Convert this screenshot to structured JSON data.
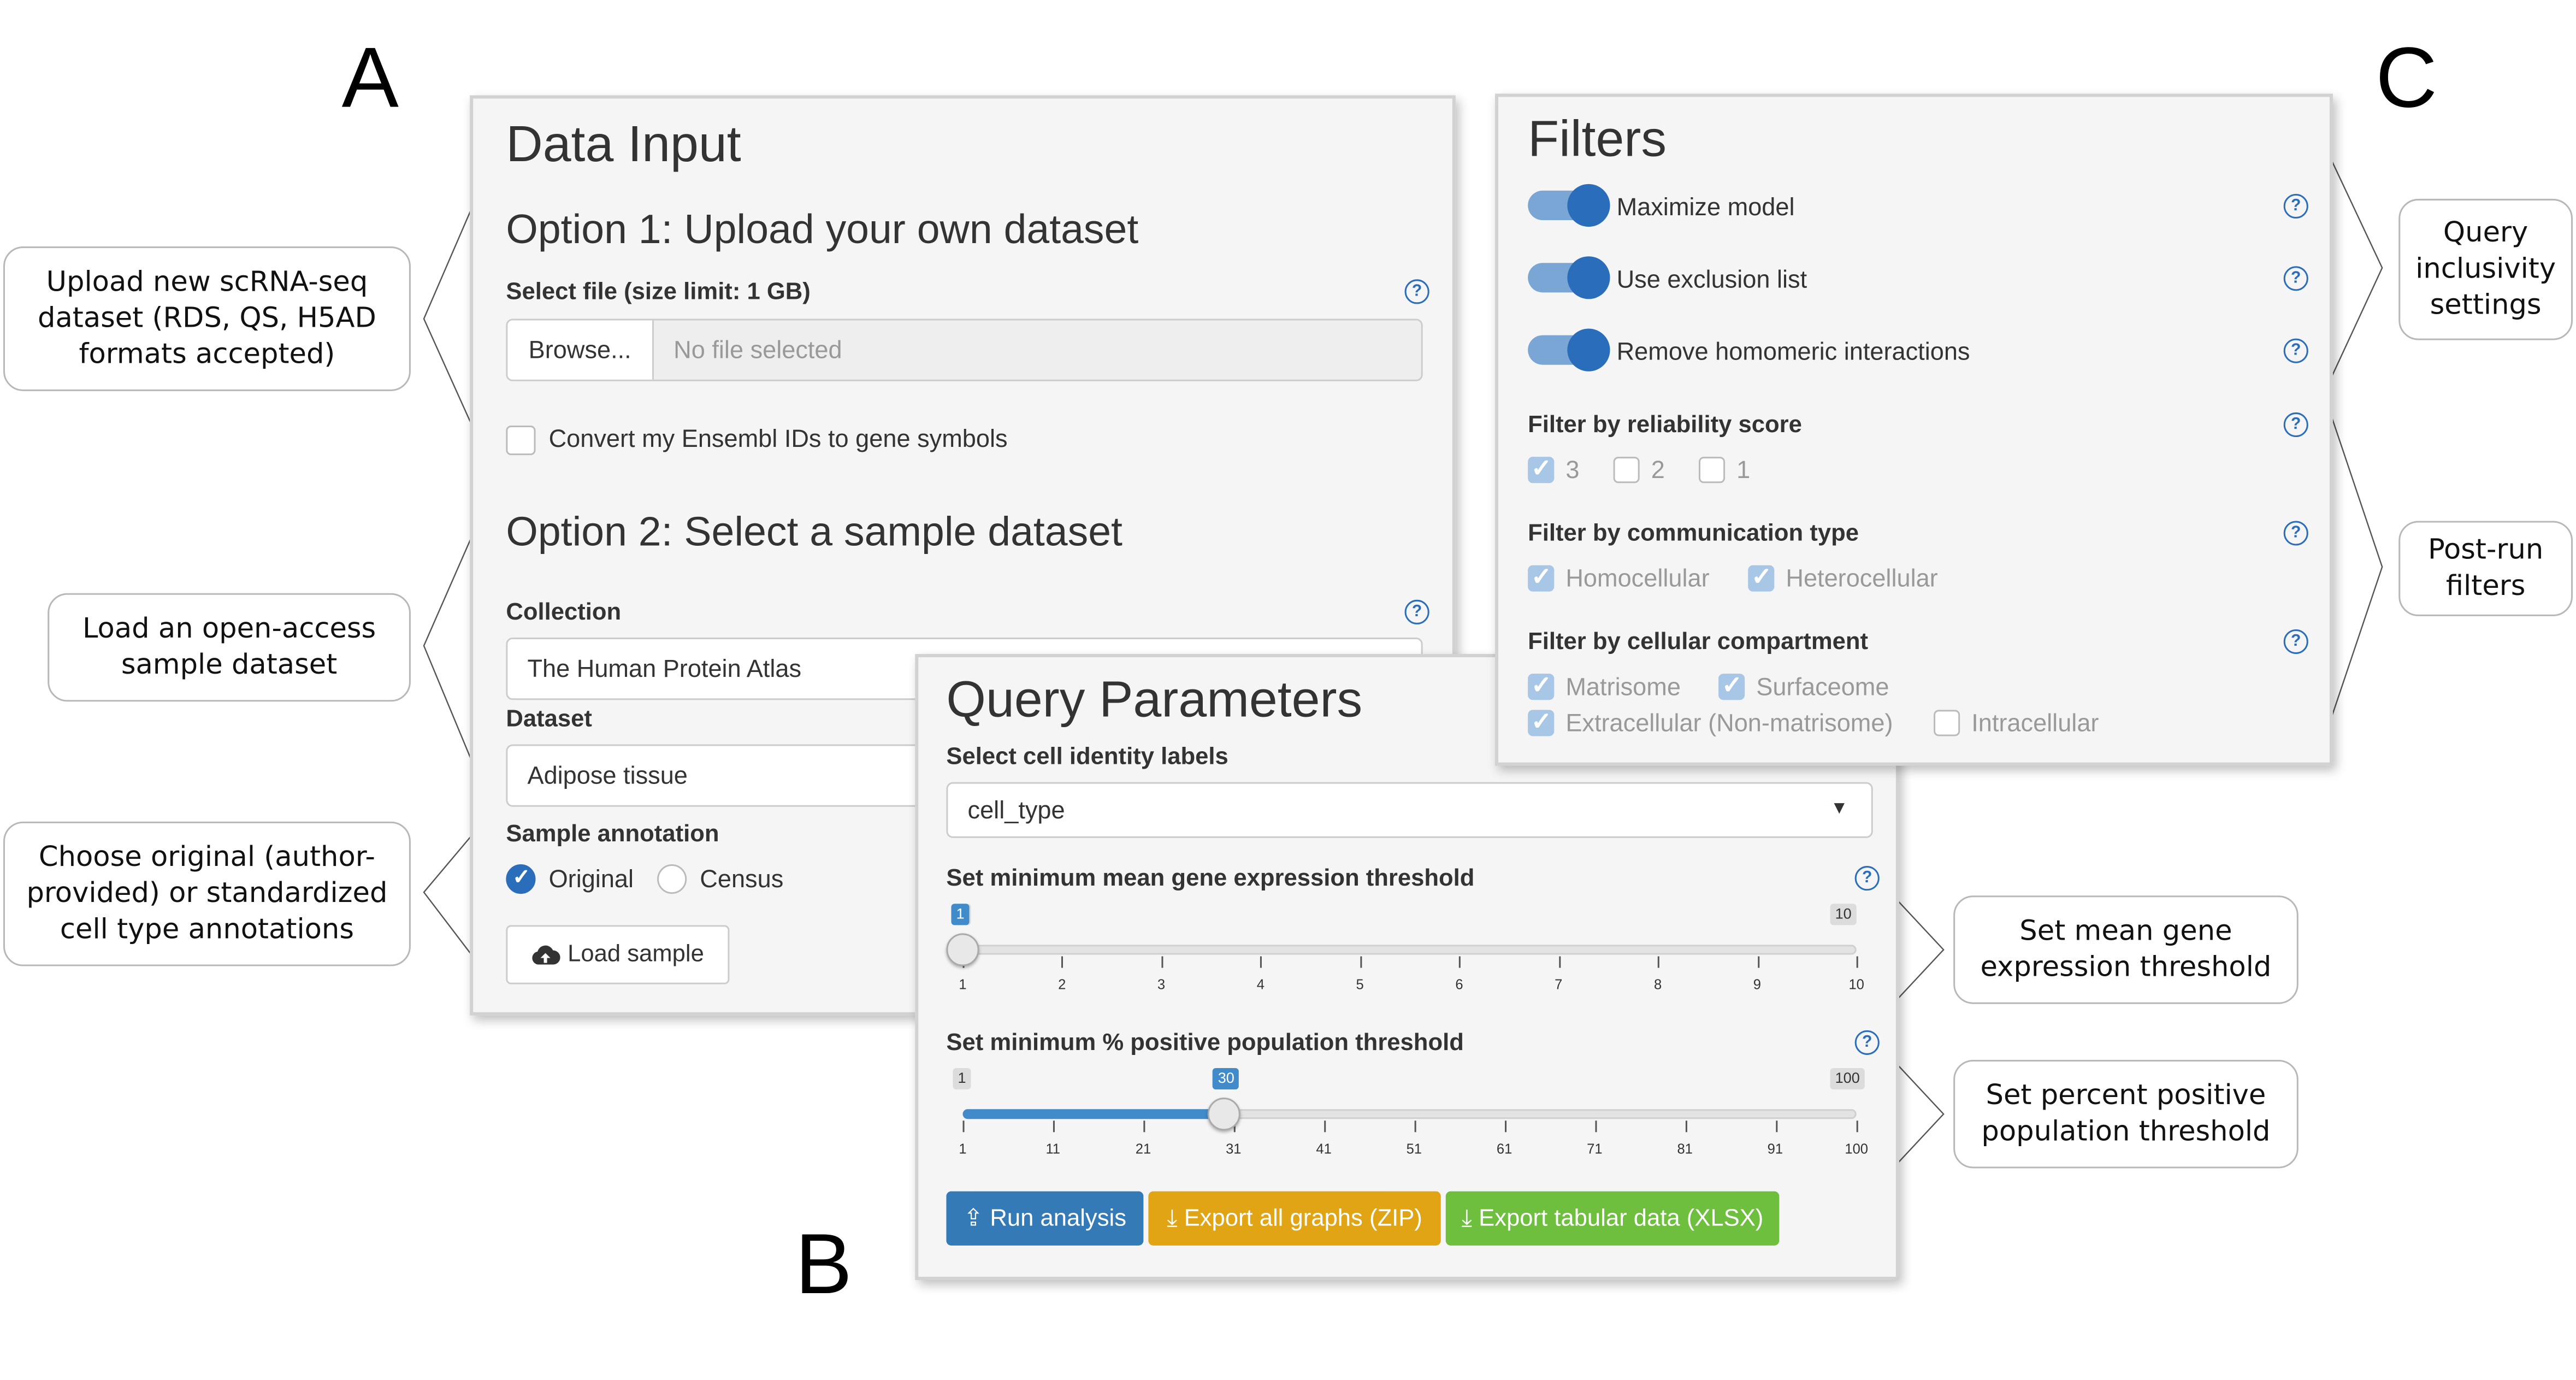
{
  "figure_letters": {
    "a": "A",
    "b": "B",
    "c": "C"
  },
  "callouts": {
    "upload": "Upload new scRNA-seq dataset (RDS, QS, H5AD formats accepted)",
    "load_sample": "Load an open-access sample dataset",
    "annotation": "Choose original (author-provided) or standardized cell type annotations",
    "mean_gene": "Set mean gene expression threshold",
    "percent_pos": "Set percent positive population threshold",
    "query_inclusivity": "Query inclusivity settings",
    "post_run": "Post-run filters"
  },
  "data_input": {
    "title": "Data Input",
    "option1_title": "Option 1: Upload your own dataset",
    "select_file_label": "Select file (size limit: 1 GB)",
    "browse_label": "Browse...",
    "file_placeholder": "No file selected",
    "convert_label": "Convert my Ensembl IDs to gene symbols",
    "convert_checked": false,
    "option2_title": "Option 2: Select a sample dataset",
    "collection_label": "Collection",
    "collection_value": "The Human Protein Atlas",
    "dataset_label": "Dataset",
    "dataset_value": "Adipose tissue",
    "annotation_label": "Sample annotation",
    "annotation_options": [
      "Original",
      "Census"
    ],
    "annotation_selected": "Original",
    "load_sample_label": "Load sample"
  },
  "query_params": {
    "title": "Query Parameters",
    "identity_label": "Select cell identity labels",
    "identity_value": "cell_type",
    "mean_label": "Set minimum mean gene expression threshold",
    "mean_slider": {
      "min": 1,
      "max": 10,
      "value": 1,
      "min_label": "1",
      "max_label": "10",
      "value_label": "1",
      "ticks": [
        "1",
        "2",
        "3",
        "4",
        "5",
        "6",
        "7",
        "8",
        "9",
        "10"
      ]
    },
    "pct_label": "Set minimum % positive population threshold",
    "pct_slider": {
      "min": 1,
      "max": 100,
      "value": 30,
      "min_label": "1",
      "max_label": "100",
      "value_label": "30",
      "ticks": [
        "1",
        "11",
        "21",
        "31",
        "41",
        "51",
        "61",
        "71",
        "81",
        "91",
        "100"
      ]
    },
    "run_label": "Run analysis",
    "export_zip_label": "Export all graphs (ZIP)",
    "export_xlsx_label": "Export tabular data (XLSX)"
  },
  "filters": {
    "title": "Filters",
    "toggles": [
      {
        "label": "Maximize model",
        "on": true
      },
      {
        "label": "Use exclusion list",
        "on": true
      },
      {
        "label": "Remove homomeric interactions",
        "on": true
      }
    ],
    "reliability_label": "Filter by reliability score",
    "reliability_options": [
      {
        "label": "3",
        "checked": true
      },
      {
        "label": "2",
        "checked": false
      },
      {
        "label": "1",
        "checked": false
      }
    ],
    "comm_label": "Filter by communication type",
    "comm_options": [
      {
        "label": "Homocellular",
        "checked": true
      },
      {
        "label": "Heterocellular",
        "checked": true
      }
    ],
    "compartment_label": "Filter by cellular compartment",
    "compartment_options": [
      {
        "label": "Matrisome",
        "checked": true
      },
      {
        "label": "Surfaceome",
        "checked": true
      },
      {
        "label": "Extracellular (Non-matrisome)",
        "checked": true
      },
      {
        "label": "Intracellular",
        "checked": false
      }
    ]
  },
  "colors": {
    "primary": "#337ab7",
    "warning": "#e0a414",
    "success": "#6fbf3f"
  }
}
